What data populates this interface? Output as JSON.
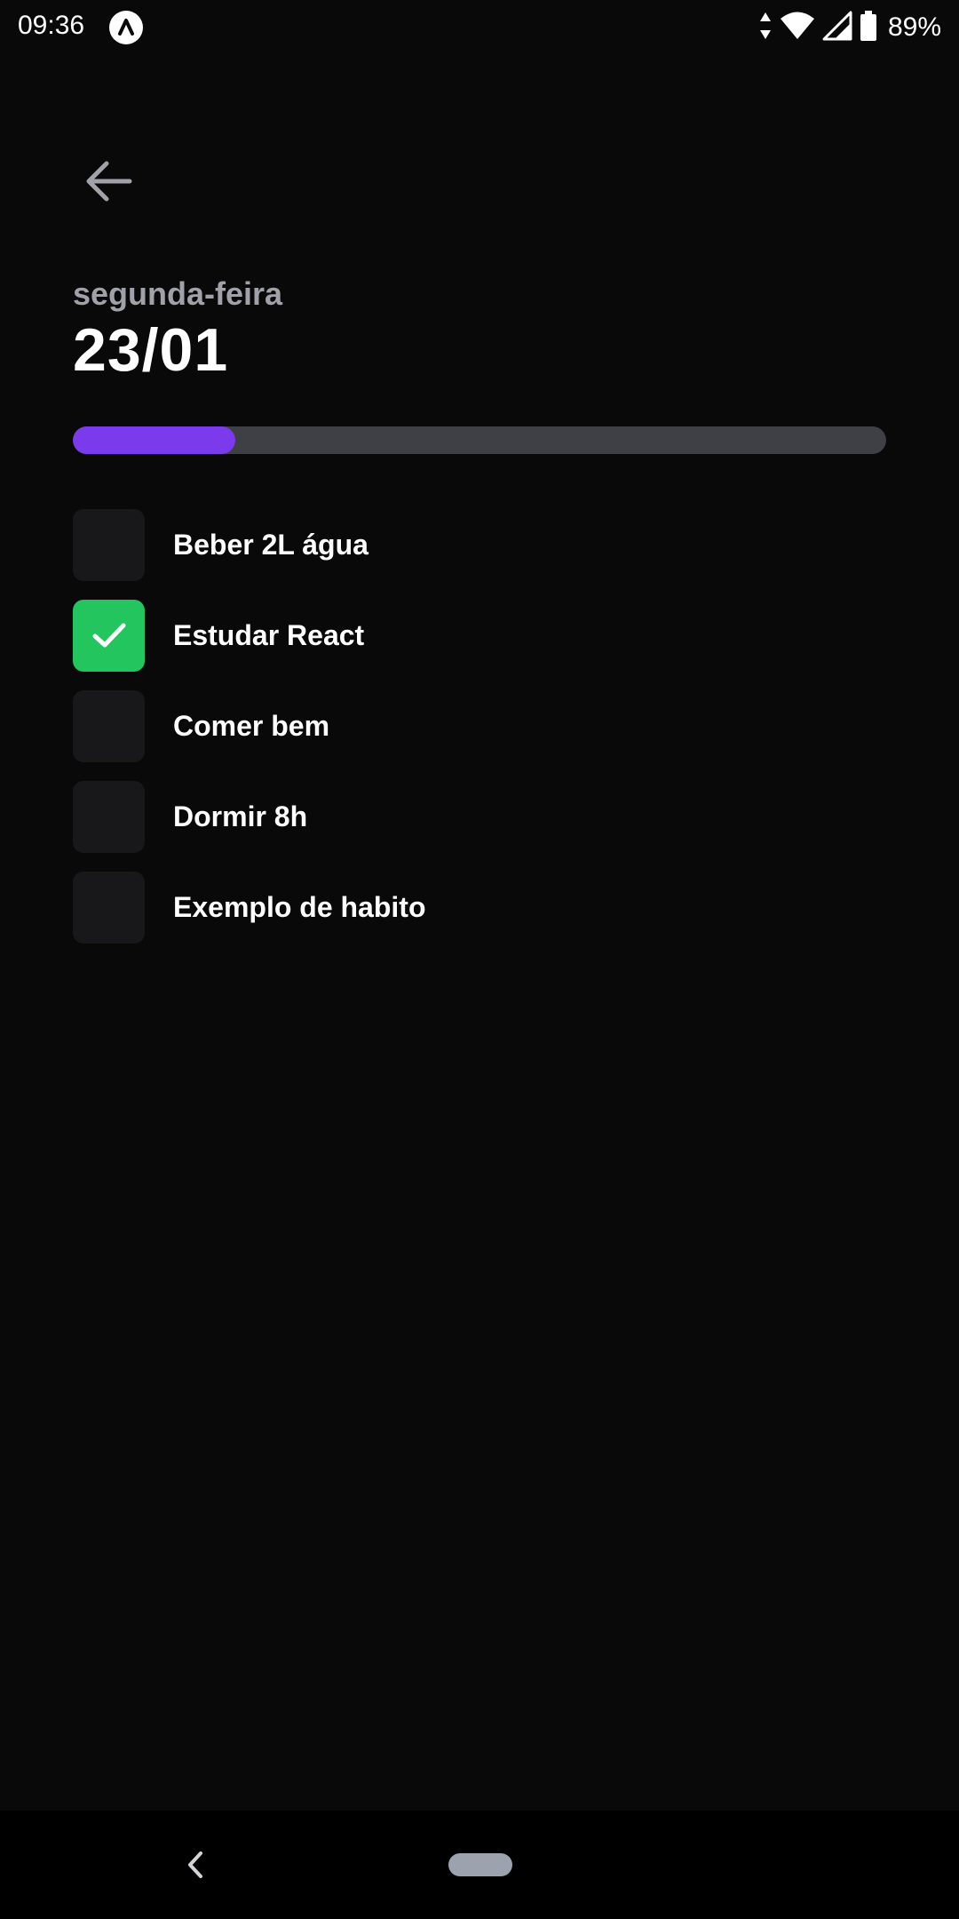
{
  "status_bar": {
    "time": "09:36",
    "battery_percent": "89%",
    "app_icon": "app-notification-icon",
    "icons": [
      "data-arrows-icon",
      "wifi-icon",
      "cell-signal-icon",
      "battery-icon"
    ]
  },
  "header": {
    "back_icon": "arrow-left-icon",
    "weekday": "segunda-feira",
    "date": "23/01"
  },
  "progress": {
    "fraction": 0.2,
    "fill_color": "#7c3aed",
    "track_color": "#3f3f46"
  },
  "habits": [
    {
      "label": "Beber 2L água",
      "completed": false
    },
    {
      "label": "Estudar React",
      "completed": true
    },
    {
      "label": "Comer bem",
      "completed": false
    },
    {
      "label": "Dormir 8h",
      "completed": false
    },
    {
      "label": "Exemplo de habito",
      "completed": false
    }
  ],
  "colors": {
    "background": "#09090a",
    "checkbox_unchecked": "#18181b",
    "checkbox_checked": "#22c55e",
    "weekday_text": "#a1a1aa"
  },
  "nav_bar": {
    "icons": [
      "nav-back-icon",
      "home-pill-icon"
    ]
  }
}
